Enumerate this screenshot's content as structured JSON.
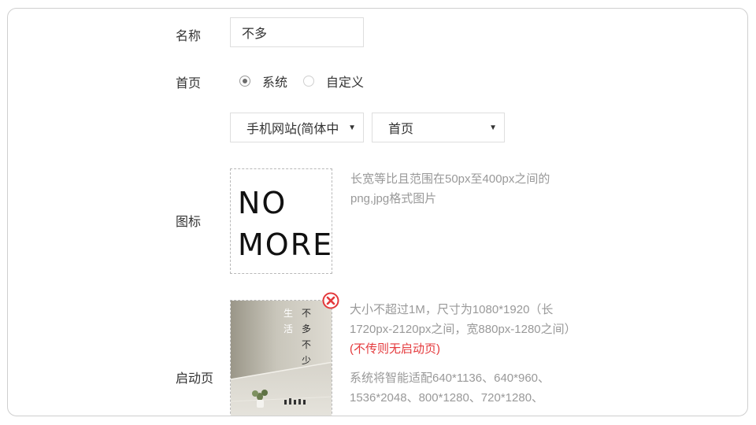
{
  "form": {
    "name_label": "名称",
    "name_value": "不多",
    "home_label": "首页",
    "home_options": [
      "系统",
      "自定义"
    ],
    "home_selected": "系统",
    "site_select_value": "手机网站(简体中",
    "page_select_value": "首页",
    "icon_label": "图标",
    "icon_logo_lines": [
      "NO",
      "MORE"
    ],
    "icon_hint": "长宽等比且范围在50px至400px之间的png,jpg格式图片",
    "launch_label": "启动页",
    "launch_image_text": [
      "生",
      "活",
      "不",
      "多",
      "不",
      "少"
    ],
    "launch_hint_main": "大小不超过1M，尺寸为1080*1920（长1720px-2120px之间，宽880px-1280之间）",
    "launch_hint_red": "(不传则无启动页)",
    "launch_hint_2": "系统将智能适配640*1136、640*960、1536*2048、800*1280、720*1280、"
  },
  "icons": {
    "radio": "radio-circle",
    "caret": "triangle-down-icon",
    "remove": "red-x-circle-icon"
  },
  "colors": {
    "red": "#e4393c",
    "hint": "#999999"
  }
}
